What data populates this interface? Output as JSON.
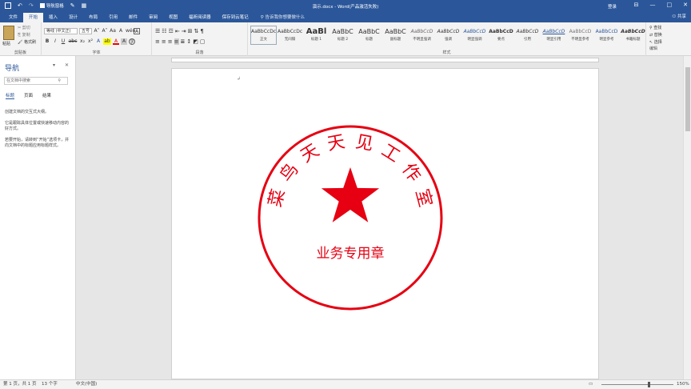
{
  "titlebar": {
    "nav_pane_label": "导航窗格",
    "doc_title": "演示.docx - Word(产品激活失败)",
    "login": "登录",
    "minimize": "—",
    "restore": "□",
    "close": "✕"
  },
  "tabs": [
    "文件",
    "开始",
    "插入",
    "设计",
    "布局",
    "引用",
    "邮件",
    "审阅",
    "视图",
    "福昕阅读器",
    "保存到云笔记"
  ],
  "active_tab": "开始",
  "tell_me": "告诉我你想要做什么",
  "share": "共享",
  "clipboard": {
    "paste": "粘贴",
    "cut": "剪切",
    "copy": "复制",
    "format_painter": "格式刷",
    "group": "剪贴板"
  },
  "font": {
    "name": "等线 (中文正)",
    "size": "五号",
    "group": "字体",
    "grow": "A˄",
    "shrink": "A˅",
    "aa": "Aa",
    "clear": "A",
    "pinyin": "wén",
    "border_a": "A",
    "bold": "B",
    "italic": "I",
    "underline": "U",
    "strike": "abc",
    "sub": "x₂",
    "sup": "x²",
    "effects": "A",
    "highlight": "ab",
    "color": "A",
    "shade": "A",
    "circle": "字"
  },
  "paragraph": {
    "group": "段落"
  },
  "styles": {
    "group": "样式",
    "items": [
      {
        "sample": "AaBbCcDc",
        "name": "正文"
      },
      {
        "sample": "AaBbCcDc",
        "name": "无间隔"
      },
      {
        "sample": "AaBl",
        "name": "标题 1"
      },
      {
        "sample": "AaBbC",
        "name": "标题 2"
      },
      {
        "sample": "AaBbC",
        "name": "标题"
      },
      {
        "sample": "AaBbC",
        "name": "副标题"
      },
      {
        "sample": "AaBbCcD",
        "name": "不明显强调"
      },
      {
        "sample": "AaBbCcD",
        "name": "强调"
      },
      {
        "sample": "AaBbCcD",
        "name": "明显强调"
      },
      {
        "sample": "AaBbCcD",
        "name": "要点"
      },
      {
        "sample": "AaBbCcD",
        "name": "引用"
      },
      {
        "sample": "AaBbCcD",
        "name": "明显引用"
      },
      {
        "sample": "AaBbCcD",
        "name": "不明显参考"
      },
      {
        "sample": "AaBbCcD",
        "name": "明显参考"
      },
      {
        "sample": "AaBbCcD",
        "name": "书籍标题"
      }
    ]
  },
  "editing": {
    "find": "查找",
    "replace": "替换",
    "select": "选择",
    "group": "编辑"
  },
  "nav_pane": {
    "title": "导航",
    "search_placeholder": "在文档中搜索",
    "tabs": [
      "标题",
      "页面",
      "结果"
    ],
    "p1": "创建文档的交互式大纲。",
    "p2": "它是跟踪具体位置或快速移动内容的好方式。",
    "p3": "若要开始，请转到“开始”选项卡，并向文档中的标题应用标题样式。"
  },
  "stamp": {
    "arc_chars": [
      "菜",
      "鸟",
      "天",
      "天",
      "见",
      "工",
      "作",
      "室"
    ],
    "bottom_text": "业务专用章",
    "color": "#e60012"
  },
  "status": {
    "page": "第 1 页，共 1 页",
    "words": "13 个字",
    "lang": "中文(中国)",
    "zoom": "150%"
  }
}
